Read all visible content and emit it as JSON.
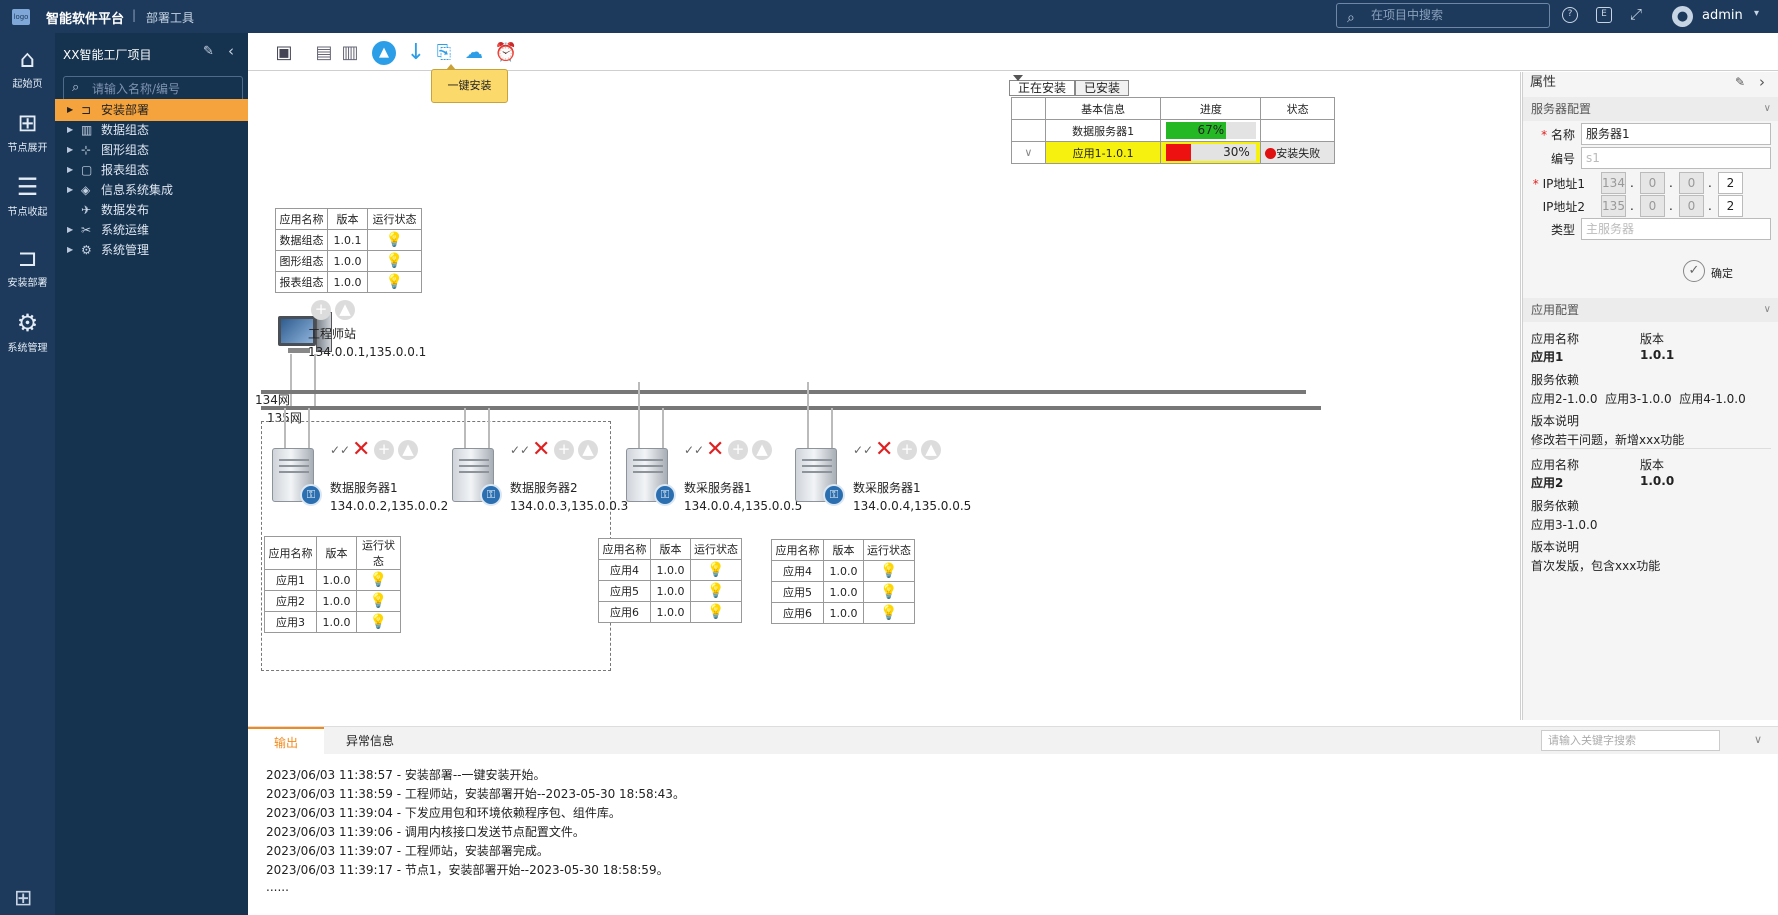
{
  "topbar": {
    "logo_text": "logo",
    "title": "智能软件平台",
    "separator": "|",
    "subtitle": "部署工具",
    "search_placeholder": "在项目中搜索",
    "user": "admin"
  },
  "leftbar": {
    "items": [
      {
        "label": "起始页",
        "icon": "home-icon"
      },
      {
        "label": "节点展开",
        "icon": "tree-expand-icon"
      },
      {
        "label": "节点收起",
        "icon": "list-collapse-icon"
      },
      {
        "label": "安装部署",
        "icon": "deploy-icon"
      },
      {
        "label": "系统管理",
        "icon": "gear-icon"
      }
    ]
  },
  "tree": {
    "project": "XX智能工厂项目",
    "search_placeholder": "请输入名称/编号",
    "nodes": [
      {
        "label": "安装部署",
        "active": true,
        "arrow": true
      },
      {
        "label": "数据组态",
        "arrow": true
      },
      {
        "label": "图形组态",
        "arrow": true
      },
      {
        "label": "报表组态",
        "arrow": true
      },
      {
        "label": "信息系统集成",
        "arrow": true
      },
      {
        "label": "数据发布",
        "arrow": false
      },
      {
        "label": "系统运维",
        "arrow": true
      },
      {
        "label": "系统管理",
        "arrow": true
      }
    ]
  },
  "toolbar": {
    "tooltip": "一键安装"
  },
  "install": {
    "tabs": [
      "正在安装",
      "已安装"
    ],
    "headers": [
      "基本信息",
      "进度",
      "状态"
    ],
    "rows": [
      {
        "name": "数据服务器1",
        "progress": 67,
        "progress_text": "67%",
        "status": "",
        "color": "#25b825",
        "highlight": false
      },
      {
        "name": "应用1-1.0.1",
        "progress": 30,
        "progress_text": "30%",
        "status": "安装失败",
        "color": "#ee1111",
        "highlight": true
      }
    ]
  },
  "app_headers": [
    "应用名称",
    "版本",
    "运行状态"
  ],
  "workstation": {
    "name": "工程师站",
    "ip": "134.0.0.1,135.0.0.1",
    "apps": [
      {
        "name": "数据组态",
        "ver": "1.0.1",
        "on": true
      },
      {
        "name": "图形组态",
        "ver": "1.0.0",
        "on": false
      },
      {
        "name": "报表组态",
        "ver": "1.0.0",
        "on": false
      }
    ]
  },
  "networks": {
    "net1": "134网",
    "net2": "135网"
  },
  "servers": [
    {
      "name": "数据服务器1",
      "ip": "134.0.0.2,135.0.0.2",
      "apps": [
        {
          "name": "应用1",
          "ver": "1.0.0",
          "on": true
        },
        {
          "name": "应用2",
          "ver": "1.0.0",
          "on": false
        },
        {
          "name": "应用3",
          "ver": "1.0.0",
          "on": false
        }
      ]
    },
    {
      "name": "数据服务器2",
      "ip": "134.0.0.3,135.0.0.3",
      "apps": []
    },
    {
      "name": "数采服务器1",
      "ip": "134.0.0.4,135.0.0.5",
      "apps": [
        {
          "name": "应用4",
          "ver": "1.0.0",
          "on": true
        },
        {
          "name": "应用5",
          "ver": "1.0.0",
          "on": false
        },
        {
          "name": "应用6",
          "ver": "1.0.0",
          "on": false
        }
      ]
    },
    {
      "name": "数采服务器1",
      "ip": "134.0.0.4,135.0.0.5",
      "apps": [
        {
          "name": "应用4",
          "ver": "1.0.0",
          "on": true
        },
        {
          "name": "应用5",
          "ver": "1.0.0",
          "on": false
        },
        {
          "name": "应用6",
          "ver": "1.0.0",
          "on": false
        }
      ]
    }
  ],
  "props": {
    "title": "属性",
    "server_section": "服务器配置",
    "name_label": "名称",
    "name_value": "服务器1",
    "code_label": "编号",
    "code_placeholder": "s1",
    "ip1_label": "IP地址1",
    "ip1": [
      "134",
      "0",
      "0",
      "2"
    ],
    "ip2_label": "IP地址2",
    "ip2": [
      "135",
      "0",
      "0",
      "2"
    ],
    "type_label": "类型",
    "type_placeholder": "主服务器",
    "confirm": "确定",
    "app_section": "应用配置",
    "app_name_label": "应用名称",
    "version_label": "版本",
    "dep_label": "服务依赖",
    "note_label": "版本说明",
    "apps": [
      {
        "name": "应用1",
        "ver": "1.0.1",
        "deps": "应用2-1.0.0  应用3-1.0.0  应用4-1.0.0",
        "note": "修改若干问题，新增xxx功能"
      },
      {
        "name": "应用2",
        "ver": "1.0.0",
        "deps": "应用3-1.0.0",
        "note": "首次发版，包含xxx功能"
      }
    ]
  },
  "output": {
    "tabs": [
      "输出",
      "异常信息"
    ],
    "search_placeholder": "请输入关键字搜索",
    "lines": [
      "2023/06/03 11:38:57 - 安装部署--一键安装开始。",
      "2023/06/03 11:38:59 - 工程师站，安装部署开始--2023-05-30 18:58:43。",
      "2023/06/03 11:39:04 - 下发应用包和环境依赖程序包、组件库。",
      "2023/06/03 11:39:06 -  调用内核接口发送节点配置文件。",
      "2023/06/03 11:39:07 -  工程师站，安装部署完成。",
      "2023/06/03 11:39:17 -  节点1，安装部署开始--2023-05-30 18:58:59。",
      "......"
    ]
  }
}
